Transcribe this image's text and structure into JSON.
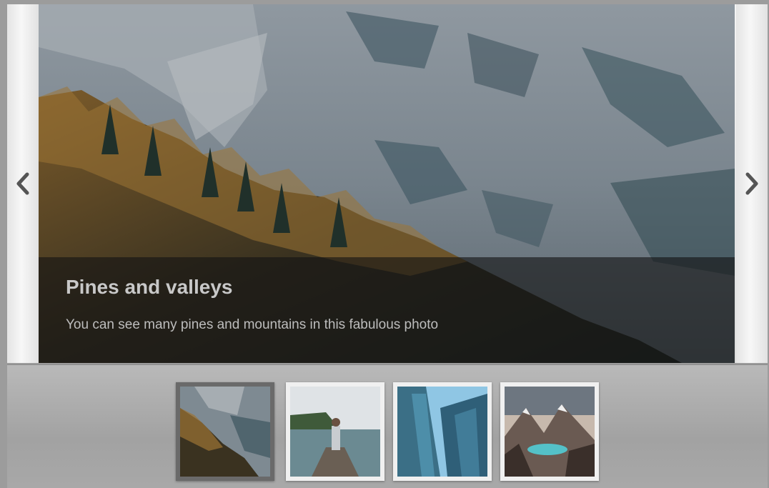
{
  "slider": {
    "prev_icon": "chevron-left-icon",
    "next_icon": "chevron-right-icon",
    "active_slide": {
      "title": "Pines and valleys",
      "description": "You can see many pines and mountains in this fabulous photo"
    }
  },
  "thumbnails": [
    {
      "name": "pines-valleys",
      "active": true
    },
    {
      "name": "woman-lake-dock",
      "active": false
    },
    {
      "name": "glass-buildings",
      "active": false
    },
    {
      "name": "mountain-lake",
      "active": false
    }
  ],
  "colors": {
    "caption_bg": "#141414",
    "nav_arrow": "#555555",
    "thumb_active_border": "#6a6a6a",
    "thumb_border": "#f0f0f0"
  }
}
